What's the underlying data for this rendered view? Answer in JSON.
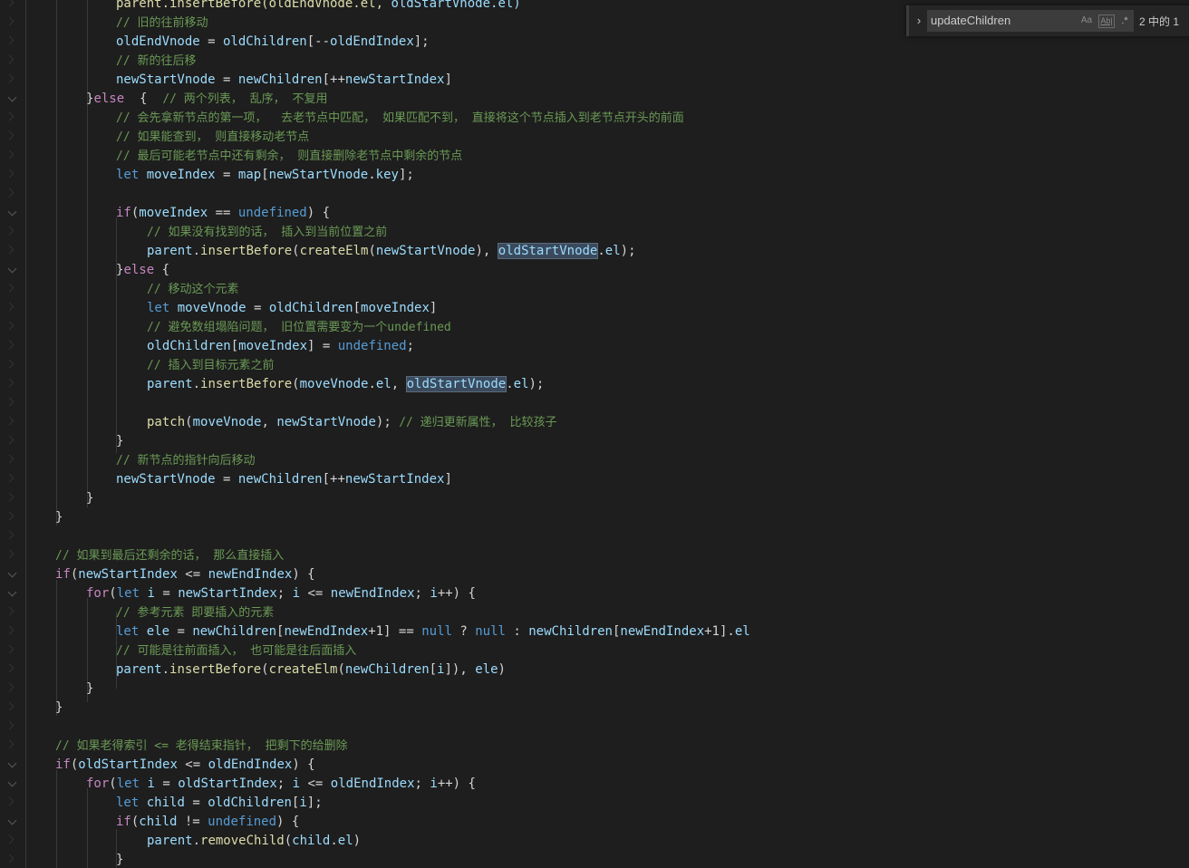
{
  "find": {
    "query": "updateChildren",
    "count": "2 中的 1",
    "opt_case": "Aa",
    "opt_word": "Ab|",
    "opt_regex": ".*"
  },
  "code": [
    [
      [
        "parent.insertBefore(oldEndVnode.el, ",
        "t-f"
      ],
      [
        "oldStartVnode.el)",
        "t-v"
      ]
    ],
    [
      [
        "// 旧的往前移动",
        "t-c"
      ]
    ],
    [
      [
        "oldEndVnode",
        "t-v"
      ],
      [
        " = ",
        "t-n"
      ],
      [
        "oldChildren",
        "t-v"
      ],
      [
        "[--",
        "t-n"
      ],
      [
        "oldEndIndex",
        "t-v"
      ],
      [
        "];",
        "t-n"
      ]
    ],
    [
      [
        "// 新的往后移",
        "t-c"
      ]
    ],
    [
      [
        "newStartVnode",
        "t-v"
      ],
      [
        " = ",
        "t-n"
      ],
      [
        "newChildren",
        "t-v"
      ],
      [
        "[++",
        "t-n"
      ],
      [
        "newStartIndex",
        "t-v"
      ],
      [
        "]",
        "t-n"
      ]
    ],
    [
      [
        "}",
        "t-b"
      ],
      [
        "else",
        "t-kw"
      ],
      [
        "  {  ",
        "t-n"
      ],
      [
        "// 两个列表， 乱序， 不复用",
        "t-c"
      ]
    ],
    [
      [
        "// 会先拿新节点的第一项，  去老节点中匹配， 如果匹配不到， 直接将这个节点插入到老节点开头的前面",
        "t-c"
      ]
    ],
    [
      [
        "// 如果能查到， 则直接移动老节点",
        "t-c"
      ]
    ],
    [
      [
        "// 最后可能老节点中还有剩余， 则直接删除老节点中剩余的节点",
        "t-c"
      ]
    ],
    [
      [
        "let",
        "t-k"
      ],
      [
        " ",
        "t-n"
      ],
      [
        "moveIndex",
        "t-v"
      ],
      [
        " = ",
        "t-n"
      ],
      [
        "map",
        "t-v"
      ],
      [
        "[",
        "t-n"
      ],
      [
        "newStartVnode",
        "t-v"
      ],
      [
        ".",
        "t-n"
      ],
      [
        "key",
        "t-v"
      ],
      [
        "];",
        "t-n"
      ]
    ],
    [],
    [
      [
        "if",
        "t-kw"
      ],
      [
        "(",
        "t-n"
      ],
      [
        "moveIndex",
        "t-v"
      ],
      [
        " == ",
        "t-n"
      ],
      [
        "undefined",
        "t-k"
      ],
      [
        ") {",
        "t-n"
      ]
    ],
    [
      [
        "// 如果没有找到的话， 插入到当前位置之前",
        "t-c"
      ]
    ],
    [
      [
        "parent",
        "t-v"
      ],
      [
        ".",
        "t-n"
      ],
      [
        "insertBefore",
        "t-f"
      ],
      [
        "(",
        "t-n"
      ],
      [
        "createElm",
        "t-f"
      ],
      [
        "(",
        "t-n"
      ],
      [
        "newStartVnode",
        "t-v"
      ],
      [
        "), ",
        "t-n"
      ],
      [
        "oldStartVnode",
        "t-v t-hl"
      ],
      [
        ".",
        "t-n"
      ],
      [
        "el",
        "t-v"
      ],
      [
        ");",
        "t-n"
      ]
    ],
    [
      [
        "}",
        "t-b"
      ],
      [
        "else",
        "t-kw"
      ],
      [
        " {",
        "t-n"
      ]
    ],
    [
      [
        "// 移动这个元素",
        "t-c"
      ]
    ],
    [
      [
        "let",
        "t-k"
      ],
      [
        " ",
        "t-n"
      ],
      [
        "moveVnode",
        "t-v"
      ],
      [
        " = ",
        "t-n"
      ],
      [
        "oldChildren",
        "t-v"
      ],
      [
        "[",
        "t-n"
      ],
      [
        "moveIndex",
        "t-v"
      ],
      [
        "]",
        "t-n"
      ]
    ],
    [
      [
        "// 避免数组塌陷问题， 旧位置需要变为一个undefined",
        "t-c"
      ]
    ],
    [
      [
        "oldChildren",
        "t-v"
      ],
      [
        "[",
        "t-n"
      ],
      [
        "moveIndex",
        "t-v"
      ],
      [
        "] = ",
        "t-n"
      ],
      [
        "undefined",
        "t-k"
      ],
      [
        ";",
        "t-n"
      ]
    ],
    [
      [
        "// 插入到目标元素之前",
        "t-c"
      ]
    ],
    [
      [
        "parent",
        "t-v"
      ],
      [
        ".",
        "t-n"
      ],
      [
        "insertBefore",
        "t-f"
      ],
      [
        "(",
        "t-n"
      ],
      [
        "moveVnode",
        "t-v"
      ],
      [
        ".",
        "t-n"
      ],
      [
        "el",
        "t-v"
      ],
      [
        ", ",
        "t-n"
      ],
      [
        "oldStartVnode",
        "t-v t-hl"
      ],
      [
        ".",
        "t-n"
      ],
      [
        "el",
        "t-v"
      ],
      [
        ");",
        "t-n"
      ]
    ],
    [],
    [
      [
        "patch",
        "t-f"
      ],
      [
        "(",
        "t-n"
      ],
      [
        "moveVnode",
        "t-v"
      ],
      [
        ", ",
        "t-n"
      ],
      [
        "newStartVnode",
        "t-v"
      ],
      [
        "); ",
        "t-n"
      ],
      [
        "// 递归更新属性， 比较孩子",
        "t-c"
      ]
    ],
    [
      [
        "}",
        "t-n"
      ]
    ],
    [
      [
        "// 新节点的指针向后移动",
        "t-c"
      ]
    ],
    [
      [
        "newStartVnode",
        "t-v"
      ],
      [
        " = ",
        "t-n"
      ],
      [
        "newChildren",
        "t-v"
      ],
      [
        "[++",
        "t-n"
      ],
      [
        "newStartIndex",
        "t-v"
      ],
      [
        "]",
        "t-n"
      ]
    ],
    [
      [
        "}",
        "t-n"
      ]
    ],
    [
      [
        "}",
        "t-n"
      ]
    ],
    [],
    [
      [
        "// 如果到最后还剩余的话， 那么直接插入",
        "t-c"
      ]
    ],
    [
      [
        "if",
        "t-kw"
      ],
      [
        "(",
        "t-n"
      ],
      [
        "newStartIndex",
        "t-v"
      ],
      [
        " <= ",
        "t-n"
      ],
      [
        "newEndIndex",
        "t-v"
      ],
      [
        ") {",
        "t-n"
      ]
    ],
    [
      [
        "for",
        "t-kw"
      ],
      [
        "(",
        "t-n"
      ],
      [
        "let",
        "t-k"
      ],
      [
        " ",
        "t-n"
      ],
      [
        "i",
        "t-v"
      ],
      [
        " = ",
        "t-n"
      ],
      [
        "newStartIndex",
        "t-v"
      ],
      [
        "; ",
        "t-n"
      ],
      [
        "i",
        "t-v"
      ],
      [
        " <= ",
        "t-n"
      ],
      [
        "newEndIndex",
        "t-v"
      ],
      [
        "; ",
        "t-n"
      ],
      [
        "i",
        "t-v"
      ],
      [
        "++) {",
        "t-n"
      ]
    ],
    [
      [
        "// 参考元素 即要插入的元素",
        "t-c"
      ]
    ],
    [
      [
        "let",
        "t-k"
      ],
      [
        " ",
        "t-n"
      ],
      [
        "ele",
        "t-v"
      ],
      [
        " = ",
        "t-n"
      ],
      [
        "newChildren",
        "t-v"
      ],
      [
        "[",
        "t-n"
      ],
      [
        "newEndIndex",
        "t-v"
      ],
      [
        "+1] == ",
        "t-n"
      ],
      [
        "null",
        "t-k"
      ],
      [
        " ? ",
        "t-n"
      ],
      [
        "null",
        "t-k"
      ],
      [
        " : ",
        "t-n"
      ],
      [
        "newChildren",
        "t-v"
      ],
      [
        "[",
        "t-n"
      ],
      [
        "newEndIndex",
        "t-v"
      ],
      [
        "+1].",
        "t-n"
      ],
      [
        "el",
        "t-v"
      ]
    ],
    [
      [
        "// 可能是往前面插入， 也可能是往后面插入",
        "t-c"
      ]
    ],
    [
      [
        "parent",
        "t-v"
      ],
      [
        ".",
        "t-n"
      ],
      [
        "insertBefore",
        "t-f"
      ],
      [
        "(",
        "t-n"
      ],
      [
        "createElm",
        "t-f"
      ],
      [
        "(",
        "t-n"
      ],
      [
        "newChildren",
        "t-v"
      ],
      [
        "[",
        "t-n"
      ],
      [
        "i",
        "t-v"
      ],
      [
        "]), ",
        "t-n"
      ],
      [
        "ele",
        "t-v"
      ],
      [
        ")",
        "t-n"
      ]
    ],
    [
      [
        "}",
        "t-n"
      ]
    ],
    [
      [
        "}",
        "t-n"
      ]
    ],
    [],
    [
      [
        "// 如果老得索引 <= 老得结束指针， 把剩下的给删除",
        "t-c"
      ]
    ],
    [
      [
        "if",
        "t-kw"
      ],
      [
        "(",
        "t-n"
      ],
      [
        "oldStartIndex",
        "t-v"
      ],
      [
        " <= ",
        "t-n"
      ],
      [
        "oldEndIndex",
        "t-v"
      ],
      [
        ") {",
        "t-n"
      ]
    ],
    [
      [
        "for",
        "t-kw"
      ],
      [
        "(",
        "t-n"
      ],
      [
        "let",
        "t-k"
      ],
      [
        " ",
        "t-n"
      ],
      [
        "i",
        "t-v"
      ],
      [
        " = ",
        "t-n"
      ],
      [
        "oldStartIndex",
        "t-v"
      ],
      [
        "; ",
        "t-n"
      ],
      [
        "i",
        "t-v"
      ],
      [
        " <= ",
        "t-n"
      ],
      [
        "oldEndIndex",
        "t-v"
      ],
      [
        "; ",
        "t-n"
      ],
      [
        "i",
        "t-v"
      ],
      [
        "++) {",
        "t-n"
      ]
    ],
    [
      [
        "let",
        "t-k"
      ],
      [
        " ",
        "t-n"
      ],
      [
        "child",
        "t-v"
      ],
      [
        " = ",
        "t-n"
      ],
      [
        "oldChildren",
        "t-v"
      ],
      [
        "[",
        "t-n"
      ],
      [
        "i",
        "t-v"
      ],
      [
        "];",
        "t-n"
      ]
    ],
    [
      [
        "if",
        "t-kw"
      ],
      [
        "(",
        "t-n"
      ],
      [
        "child",
        "t-v"
      ],
      [
        " != ",
        "t-n"
      ],
      [
        "undefined",
        "t-k"
      ],
      [
        ") {",
        "t-n"
      ]
    ],
    [
      [
        "parent",
        "t-v"
      ],
      [
        ".",
        "t-n"
      ],
      [
        "removeChild",
        "t-f"
      ],
      [
        "(",
        "t-n"
      ],
      [
        "child",
        "t-v"
      ],
      [
        ".",
        "t-n"
      ],
      [
        "el",
        "t-v"
      ],
      [
        ")",
        "t-n"
      ]
    ],
    [
      [
        "}",
        "t-n"
      ]
    ]
  ]
}
